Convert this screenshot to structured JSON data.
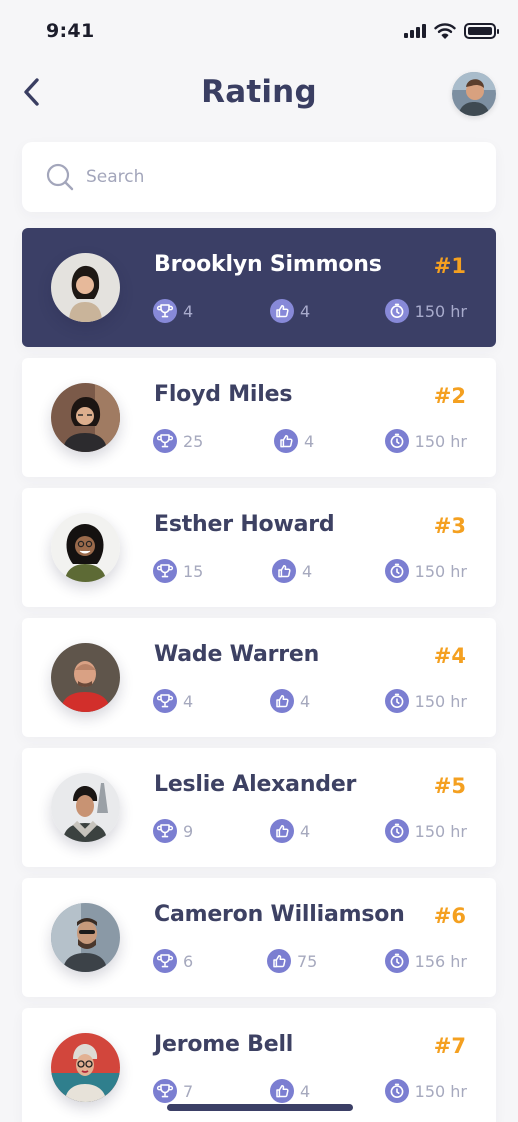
{
  "status_bar": {
    "time": "9:41"
  },
  "header": {
    "title": "Rating"
  },
  "search": {
    "placeholder": "Search"
  },
  "colors": {
    "primary": "#3b3f66",
    "accent": "#f4a020",
    "icon_bg": "#7b7ed1",
    "muted": "#a6a9be"
  },
  "users": [
    {
      "name": "Brooklyn Simmons",
      "rank": "#1",
      "trophies": "4",
      "likes": "4",
      "hours": "150 hr"
    },
    {
      "name": "Floyd Miles",
      "rank": "#2",
      "trophies": "25",
      "likes": "4",
      "hours": "150 hr"
    },
    {
      "name": "Esther Howard",
      "rank": "#3",
      "trophies": "15",
      "likes": "4",
      "hours": "150 hr"
    },
    {
      "name": "Wade Warren",
      "rank": "#4",
      "trophies": "4",
      "likes": "4",
      "hours": "150 hr"
    },
    {
      "name": "Leslie Alexander",
      "rank": "#5",
      "trophies": "9",
      "likes": "4",
      "hours": "150 hr"
    },
    {
      "name": "Cameron Williamson",
      "rank": "#6",
      "trophies": "6",
      "likes": "75",
      "hours": "156 hr"
    },
    {
      "name": "Jerome Bell",
      "rank": "#7",
      "trophies": "7",
      "likes": "4",
      "hours": "150 hr"
    }
  ]
}
